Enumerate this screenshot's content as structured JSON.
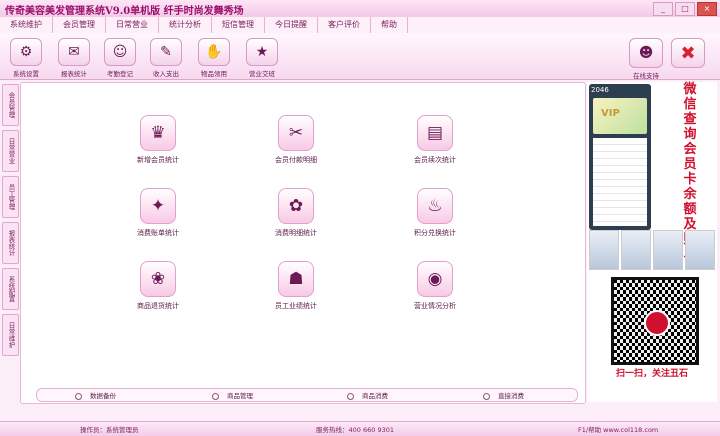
{
  "window": {
    "title": "传奇美容美发管理系统V9.0单机版  纤手时尚发舞秀场"
  },
  "menu": [
    "系统维护",
    "会员管理",
    "日常营业",
    "统计分析",
    "短信管理",
    "今日提醒",
    "客户评价",
    "帮助"
  ],
  "toolbar": [
    {
      "label": "系统设置",
      "icon": "gear-icon",
      "glyph": "⚙"
    },
    {
      "label": "报表统计",
      "icon": "report-icon",
      "glyph": "✉"
    },
    {
      "label": "考勤登记",
      "icon": "attendance-icon",
      "glyph": "☺"
    },
    {
      "label": "收入支出",
      "icon": "income-icon",
      "glyph": "✎"
    },
    {
      "label": "物品领用",
      "icon": "goods-icon",
      "glyph": "✋"
    },
    {
      "label": "营业交班",
      "icon": "shift-icon",
      "glyph": "★"
    }
  ],
  "toolbar_right": [
    {
      "label": "在线支持",
      "icon": "qq-penguin-icon",
      "glyph": "☻"
    },
    {
      "label": "",
      "icon": "exit-icon",
      "glyph": "✖"
    }
  ],
  "sidetabs": [
    "会员管理",
    "日常营业",
    "员工管理",
    "报表统计",
    "系统配置",
    "日常维护"
  ],
  "functions": [
    {
      "label": "新增会员统计",
      "icon": "new-member-icon",
      "glyph": "♛"
    },
    {
      "label": "会员付款明细",
      "icon": "payment-icon",
      "glyph": "✂"
    },
    {
      "label": "会员续次统计",
      "icon": "renew-icon",
      "glyph": "▤"
    },
    {
      "label": "消费账单统计",
      "icon": "bill-icon",
      "glyph": "✦"
    },
    {
      "label": "消费明细统计",
      "icon": "consume-detail-icon",
      "glyph": "✿"
    },
    {
      "label": "积分兑换统计",
      "icon": "points-icon",
      "glyph": "♨"
    },
    {
      "label": "商品退货统计",
      "icon": "return-icon",
      "glyph": "❀"
    },
    {
      "label": "员工业绩统计",
      "icon": "staff-icon",
      "glyph": "☗"
    },
    {
      "label": "营业情况分析",
      "icon": "analysis-icon",
      "glyph": "◉"
    }
  ],
  "quick": [
    "数据备份",
    "商品管理",
    "商品消费",
    "直接消费"
  ],
  "ad": {
    "vertical_text": "微信查询会员卡余额及账单",
    "caption": "扫一扫，关注丑石",
    "phone_header": "2046",
    "card_text": "VIP"
  },
  "status": {
    "operator": "操作员：系统管理员",
    "hotline": "服务热线：400 660 9301",
    "help": "F1/帮助 www.col118.com"
  }
}
